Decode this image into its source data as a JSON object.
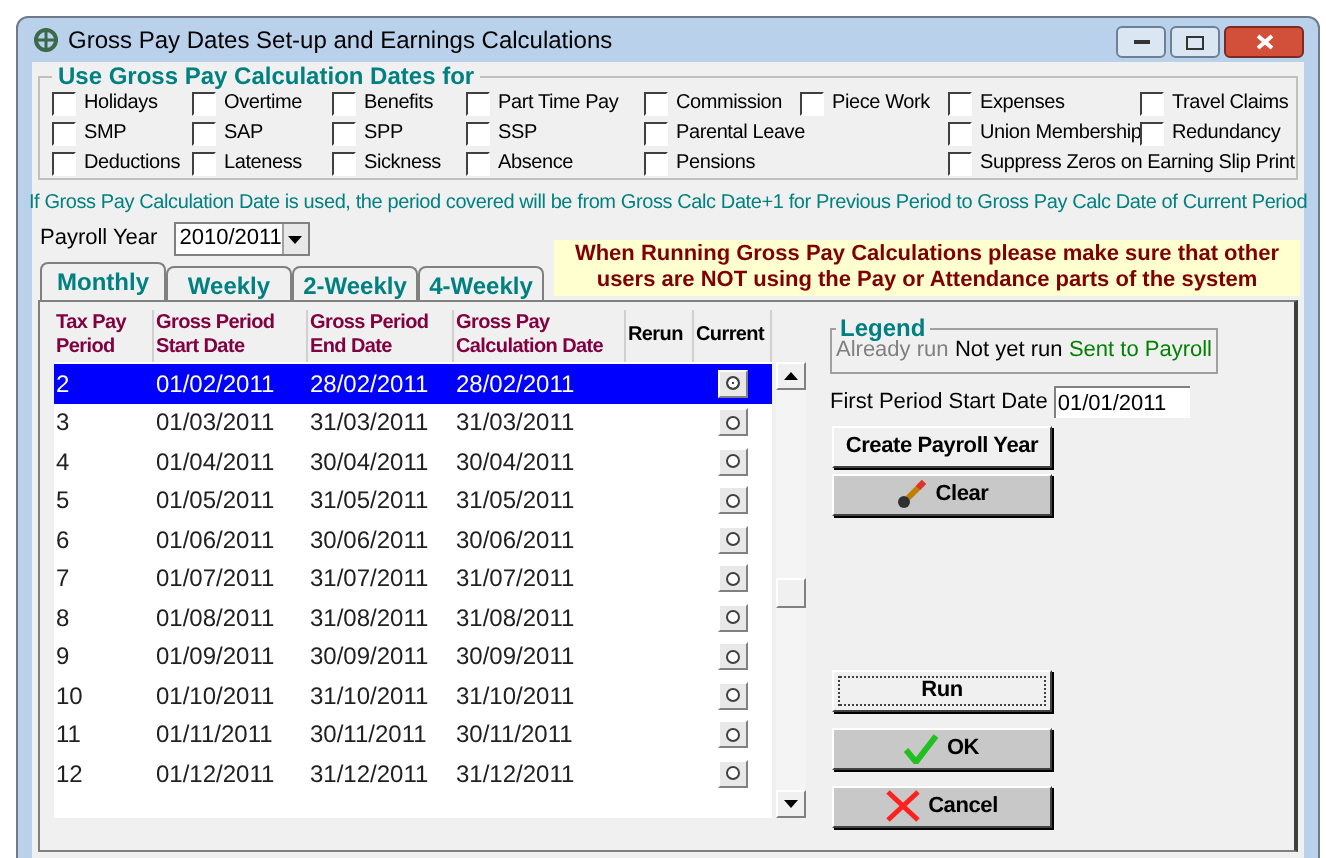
{
  "window": {
    "title": "Gross Pay Dates Set-up and Earnings Calculations"
  },
  "options": {
    "title": "Use Gross Pay Calculation Dates for",
    "columns": [
      [
        {
          "label": "Holidays",
          "checked": false
        },
        {
          "label": "SMP",
          "checked": false
        },
        {
          "label": "Deductions",
          "checked": false
        }
      ],
      [
        {
          "label": "Overtime",
          "checked": false
        },
        {
          "label": "SAP",
          "checked": false
        },
        {
          "label": "Lateness",
          "checked": false
        }
      ],
      [
        {
          "label": "Benefits",
          "checked": false
        },
        {
          "label": "SPP",
          "checked": false
        },
        {
          "label": "Sickness",
          "checked": false
        }
      ],
      [
        {
          "label": "Part Time Pay",
          "checked": false
        },
        {
          "label": "SSP",
          "checked": false
        },
        {
          "label": "Absence",
          "checked": false
        }
      ],
      [
        {
          "label": "Commission",
          "checked": false
        },
        {
          "label": "Parental Leave",
          "checked": false
        },
        {
          "label": "Pensions",
          "checked": false
        }
      ],
      [
        {
          "label": "Piece Work",
          "checked": false
        }
      ],
      [
        {
          "label": "Expenses",
          "checked": false
        },
        {
          "label": "Union Membership",
          "checked": false
        },
        {
          "label": "Suppress Zeros on Earning Slip Print",
          "checked": false
        }
      ],
      [
        {
          "label": "Travel Claims",
          "checked": false
        },
        {
          "label": "Redundancy",
          "checked": false
        }
      ]
    ]
  },
  "info_text": "If Gross Pay Calculation Date is used, the period covered will be from Gross Calc Date+1 for Previous Period to Gross Pay Calc Date of Current Period",
  "payroll_year": {
    "label": "Payroll Year",
    "value": "2010/2011"
  },
  "tabs": [
    {
      "label": "Monthly",
      "selected": true
    },
    {
      "label": "Weekly",
      "selected": false
    },
    {
      "label": "2-Weekly",
      "selected": false
    },
    {
      "label": "4-Weekly",
      "selected": false
    }
  ],
  "warning": "When Running Gross Pay Calculations please make sure that other users are NOT using the Pay or Attendance parts of the system",
  "table": {
    "columns": [
      "Tax Pay Period",
      "Gross Period Start Date",
      "Gross Period End Date",
      "Gross Pay Calculation Date",
      "Rerun",
      "Current"
    ],
    "rows": [
      {
        "cells": [
          "2",
          "01/02/2011",
          "28/02/2011",
          "28/02/2011"
        ],
        "selected": true,
        "current": true
      },
      {
        "cells": [
          "3",
          "01/03/2011",
          "31/03/2011",
          "31/03/2011"
        ],
        "selected": false,
        "current": false
      },
      {
        "cells": [
          "4",
          "01/04/2011",
          "30/04/2011",
          "30/04/2011"
        ],
        "selected": false,
        "current": false
      },
      {
        "cells": [
          "5",
          "01/05/2011",
          "31/05/2011",
          "31/05/2011"
        ],
        "selected": false,
        "current": false
      },
      {
        "cells": [
          "6",
          "01/06/2011",
          "30/06/2011",
          "30/06/2011"
        ],
        "selected": false,
        "current": false
      },
      {
        "cells": [
          "7",
          "01/07/2011",
          "31/07/2011",
          "31/07/2011"
        ],
        "selected": false,
        "current": false
      },
      {
        "cells": [
          "8",
          "01/08/2011",
          "31/08/2011",
          "31/08/2011"
        ],
        "selected": false,
        "current": false
      },
      {
        "cells": [
          "9",
          "01/09/2011",
          "30/09/2011",
          "30/09/2011"
        ],
        "selected": false,
        "current": false
      },
      {
        "cells": [
          "10",
          "01/10/2011",
          "31/10/2011",
          "31/10/2011"
        ],
        "selected": false,
        "current": false
      },
      {
        "cells": [
          "11",
          "01/11/2011",
          "30/11/2011",
          "30/11/2011"
        ],
        "selected": false,
        "current": false
      },
      {
        "cells": [
          "12",
          "01/12/2011",
          "31/12/2011",
          "31/12/2011"
        ],
        "selected": false,
        "current": false
      }
    ]
  },
  "legend": {
    "title": "Legend",
    "items": [
      {
        "label": "Already run",
        "color": "#808080"
      },
      {
        "label": "Not yet run",
        "color": "#000000"
      },
      {
        "label": "Sent to Payroll",
        "color": "#008000"
      }
    ]
  },
  "first_period": {
    "label": "First Period Start Date",
    "value": "01/01/2011"
  },
  "buttons": [
    {
      "label": "Create Payroll Year",
      "kind": "plain"
    },
    {
      "label": "Clear",
      "kind": "clear"
    },
    {
      "label": "Run",
      "kind": "run"
    },
    {
      "label": "OK",
      "kind": "ok"
    },
    {
      "label": "Cancel",
      "kind": "cancel"
    }
  ]
}
